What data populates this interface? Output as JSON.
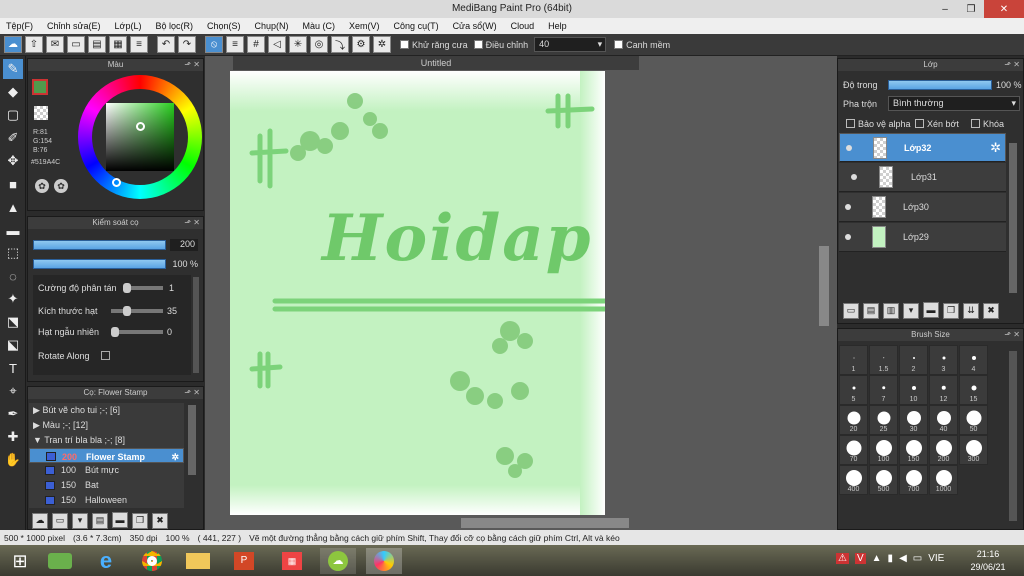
{
  "window": {
    "title": "MediBang Paint Pro (64bit)",
    "buttons": [
      "–",
      "❐",
      "✕"
    ]
  },
  "menu": [
    "Tệp(F)",
    "Chỉnh sửa(E)",
    "Lớp(L)",
    "Bộ lọc(R)",
    "Chọn(S)",
    "Chụp(N)",
    "Màu (C)",
    "Xem(V)",
    "Công cụ(T)",
    "Cửa sổ(W)",
    "Cloud",
    "Help"
  ],
  "toolbar": {
    "antialias_label": "Khử răng cưa",
    "correction_label": "Điều chỉnh",
    "correction_value": "40",
    "snap_label": "Canh mềm"
  },
  "color_panel": {
    "title": "Màu",
    "r": "R:81",
    "g": "G:154",
    "b": "B:76",
    "hex": "#519A4C",
    "accent": "#519A4C"
  },
  "brush_control": {
    "title": "Kiểm soát cọ",
    "size_value": "200",
    "opacity_value": "100 %",
    "rows": [
      {
        "label": "Cường độ phân tán",
        "value": "1"
      },
      {
        "label": "Kích thước hạt",
        "value": "35"
      },
      {
        "label": "Hạt ngẫu nhiên",
        "value": "0"
      },
      {
        "label": "Rotate Along",
        "value": ""
      }
    ]
  },
  "brush_list": {
    "title": "Cọ: Flower Stamp",
    "groups": [
      "Bút vẽ cho tui ;-; [6]",
      "Màu ;-; [12]",
      "Tran trí bla bla ;-; [8]"
    ],
    "items": [
      {
        "size": "200",
        "name": "Flower Stamp"
      },
      {
        "size": "100",
        "name": "Bút mực"
      },
      {
        "size": "150",
        "name": "Bat"
      },
      {
        "size": "150",
        "name": "Halloween"
      }
    ]
  },
  "canvas": {
    "tab": "Untitled",
    "title_text": "Hoidap"
  },
  "layer_panel": {
    "title": "Lớp",
    "opacity_label": "Độ trong",
    "opacity_value": "100 %",
    "blend_label": "Pha trộn",
    "blend_value": "Bình thường",
    "options": [
      "Bảo vệ alpha",
      "Xén bớt",
      "Khóa"
    ],
    "layers": [
      "Lớp32",
      "Lớp31",
      "Lớp30",
      "Lớp29"
    ]
  },
  "brush_size": {
    "title": "Brush Size",
    "sizes": [
      "1",
      "1.5",
      "2",
      "3",
      "4",
      "5",
      "7",
      "10",
      "12",
      "15",
      "20",
      "25",
      "30",
      "40",
      "50",
      "70",
      "100",
      "150",
      "200",
      "300",
      "400",
      "500",
      "700",
      "1000"
    ]
  },
  "status": {
    "size": "500 * 1000 pixel",
    "cm": "(3.6 * 7.3cm)",
    "dpi": "350 dpi",
    "zoom": "100 %",
    "coords": "( 441, 227 )",
    "hint": "Vẽ một đường thẳng bằng cách giữ phím Shift, Thay đổi cỡ cọ bằng cách giữ phím Ctrl, Alt và kéo"
  },
  "taskbar": {
    "lang": "VIE",
    "time": "21:16",
    "date": "29/06/21"
  }
}
